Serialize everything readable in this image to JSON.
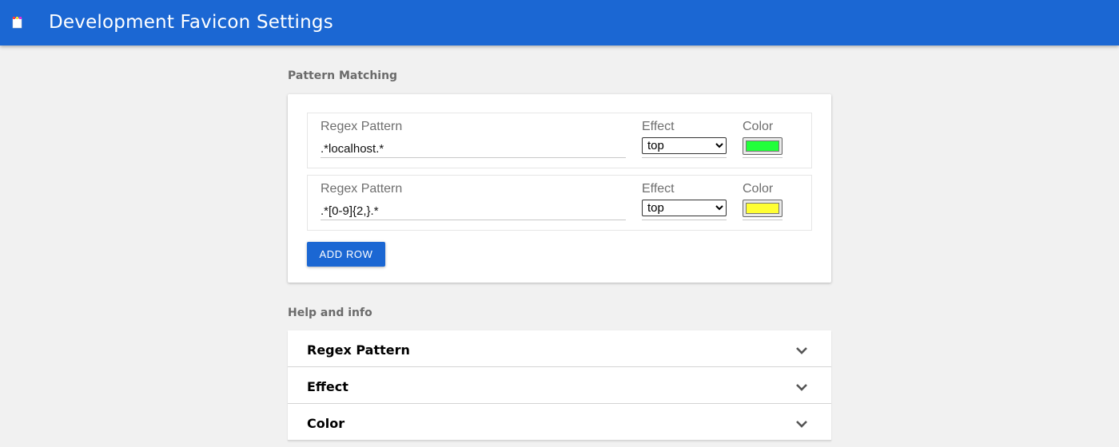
{
  "app": {
    "title": "Development Favicon Settings",
    "icon": "favicon-icon",
    "brand_color": "#1b67d3"
  },
  "pattern_matching": {
    "title": "Pattern Matching",
    "rows": [
      {
        "regex_label": "Regex Pattern",
        "regex_value": ".*localhost.*",
        "effect_label": "Effect",
        "effect_value": "top",
        "color_label": "Color",
        "color_value": "#22ff3a"
      },
      {
        "regex_label": "Regex Pattern",
        "regex_value": ".*[0-9]{2,}.*",
        "effect_label": "Effect",
        "effect_value": "top",
        "color_label": "Color",
        "color_value": "#ffff33"
      }
    ],
    "add_row_label": "ADD ROW"
  },
  "help": {
    "title": "Help and info",
    "items": [
      {
        "label": "Regex Pattern",
        "icon": "chevron-down-icon"
      },
      {
        "label": "Effect",
        "icon": "chevron-down-icon"
      },
      {
        "label": "Color",
        "icon": "chevron-down-icon"
      }
    ]
  }
}
